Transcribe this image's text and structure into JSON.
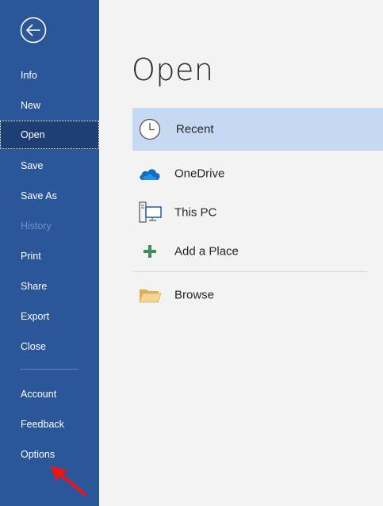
{
  "sidebar": {
    "back_icon": "back-arrow-icon",
    "items": [
      {
        "label": "Info",
        "state": "normal"
      },
      {
        "label": "New",
        "state": "normal"
      },
      {
        "label": "Open",
        "state": "active"
      },
      {
        "label": "Save",
        "state": "normal"
      },
      {
        "label": "Save As",
        "state": "normal"
      },
      {
        "label": "History",
        "state": "disabled"
      },
      {
        "label": "Print",
        "state": "normal"
      },
      {
        "label": "Share",
        "state": "normal"
      },
      {
        "label": "Export",
        "state": "normal"
      },
      {
        "label": "Close",
        "state": "normal"
      }
    ],
    "bottom_items": [
      {
        "label": "Account"
      },
      {
        "label": "Feedback"
      },
      {
        "label": "Options"
      }
    ],
    "annotation": "red-arrow-pointing-at-options"
  },
  "main": {
    "title": "Open",
    "locations": [
      {
        "label": "Recent",
        "icon": "clock-icon",
        "selected": true
      },
      {
        "label": "OneDrive",
        "icon": "cloud-icon",
        "selected": false
      },
      {
        "label": "This PC",
        "icon": "computer-icon",
        "selected": false
      },
      {
        "label": "Add a Place",
        "icon": "plus-icon",
        "selected": false
      },
      {
        "label": "Browse",
        "icon": "folder-icon",
        "selected": false
      }
    ]
  },
  "colors": {
    "sidebar_bg": "#2b579a",
    "sidebar_active": "#1e3f74",
    "selected_bg": "#c5d9f3",
    "main_bg": "#f3f3f3"
  }
}
